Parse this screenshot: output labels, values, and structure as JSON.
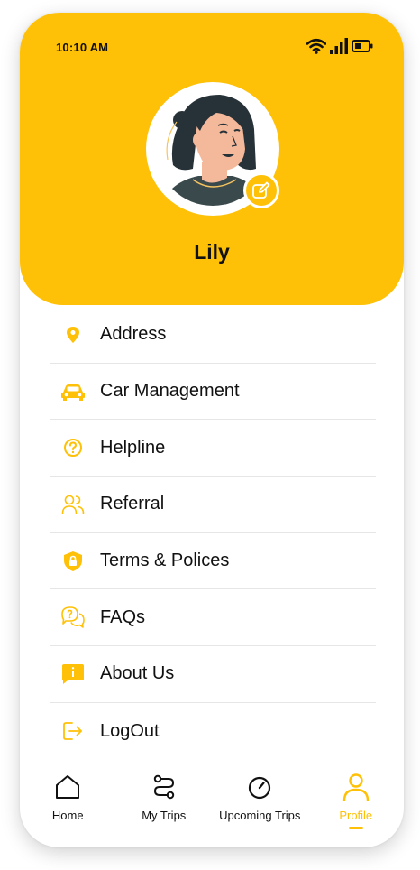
{
  "status_bar": {
    "time": "10:10 AM"
  },
  "profile": {
    "name": "Lily"
  },
  "menu": {
    "items": [
      {
        "label": "Address",
        "icon": "location-pin-icon"
      },
      {
        "label": "Car Management",
        "icon": "car-icon"
      },
      {
        "label": "Helpline",
        "icon": "help-circle-icon"
      },
      {
        "label": "Referral",
        "icon": "users-icon"
      },
      {
        "label": "Terms & Polices",
        "icon": "shield-lock-icon"
      },
      {
        "label": "FAQs",
        "icon": "faq-bubbles-icon"
      },
      {
        "label": "About Us",
        "icon": "info-message-icon"
      },
      {
        "label": "LogOut",
        "icon": "logout-icon"
      }
    ]
  },
  "tabbar": {
    "tabs": [
      {
        "label": "Home",
        "icon": "home-icon",
        "active": false
      },
      {
        "label": "My Trips",
        "icon": "route-icon",
        "active": false
      },
      {
        "label": "Upcoming Trips",
        "icon": "timer-icon",
        "active": false
      },
      {
        "label": "Profile",
        "icon": "user-icon",
        "active": true
      }
    ]
  },
  "colors": {
    "accent": "#FFC107",
    "text": "#111111",
    "divider": "#E6E6E6"
  }
}
